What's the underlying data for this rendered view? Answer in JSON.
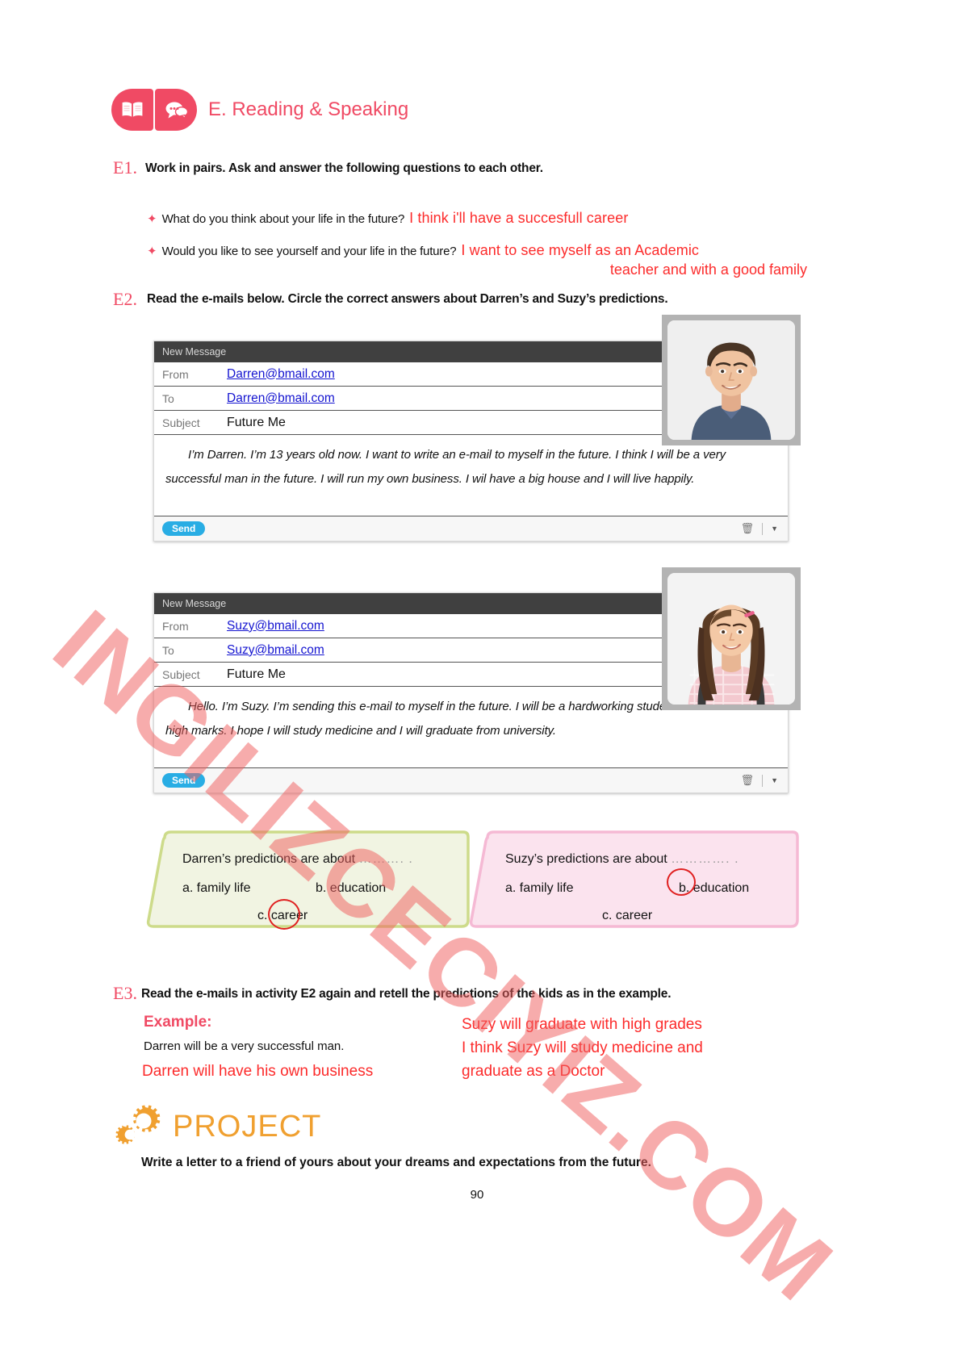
{
  "header": {
    "title": "E. Reading & Speaking",
    "icon_book": "book-icon",
    "icon_speech": "speech-bubble-icon",
    "accent_color": "#f04a64"
  },
  "e1": {
    "label": "E1.",
    "instruction": "Work in pairs. Ask and answer the following questions to each other.",
    "questions": [
      {
        "text": "What do you think about your life in the future?",
        "answer": "I think i'll have a succesfull career"
      },
      {
        "text": "Would you like to see yourself and your life in the future?",
        "answer": "I want to see myself as an Academic",
        "answer_line2": "teacher and with a good family"
      }
    ]
  },
  "e2": {
    "label": "E2.",
    "instruction": "Read the e-mails below. Circle the correct answers about Darren’s and Suzy’s predictions.",
    "emails": [
      {
        "titlebar": "New Message",
        "from_label": "From",
        "from_value": "Darren@bmail.com",
        "to_label": "To",
        "to_value": "Darren@bmail.com",
        "subject_label": "Subject",
        "subject_value": "Future Me",
        "body": "I’m Darren. I’m 13 years old now. I want to write an e-mail to myself in the future. I think I will be a very successful man in the future. I will run my own business. I wil have a big house and I will live happily.",
        "send_label": "Send",
        "trash_icon": "trash-icon",
        "caret_icon": "chevron-down-icon",
        "avatar": "boy-photo"
      },
      {
        "titlebar": "New Message",
        "from_label": "From",
        "from_value": "Suzy@bmail.com",
        "to_label": "To",
        "to_value": "Suzy@bmail.com",
        "subject_label": "Subject",
        "subject_value": "Future Me",
        "body": "Hello. I’m Suzy. I’m sending this e-mail to myself in the future. I will be a hardworking student and I will have high marks. I hope I will study medicine and I will graduate from university.",
        "send_label": "Send",
        "trash_icon": "trash-icon",
        "caret_icon": "chevron-down-icon",
        "avatar": "girl-photo"
      }
    ],
    "answer_boxes": [
      {
        "name": "darren",
        "question": "Darren’s predictions are about",
        "dots": "………. .",
        "option_a": "a. family life",
        "option_b": "b. education",
        "option_c": "c. career",
        "fill_color": "#f1f4e2",
        "stroke_color": "#cddb8a",
        "circled": "c"
      },
      {
        "name": "suzy",
        "question": "Suzy’s predictions are about",
        "dots": "…………. .",
        "option_a": "a. family life",
        "option_b": "b. education",
        "option_c": "c. career",
        "fill_color": "#fbe3ee",
        "stroke_color": "#f5b9d4",
        "circled": "b"
      }
    ]
  },
  "e3": {
    "label": "E3.",
    "instruction": "Read the e-mails in activity E2 again and retell the predictions of the kids as in the example.",
    "example_label": "Example:",
    "example_text": "Darren will be a very successful man.",
    "hand_left": "Darren will have his own business",
    "hand_right": "Suzy will graduate with high grades\nI think Suzy will study medicine and\ngraduate as a Doctor"
  },
  "project": {
    "title": "PROJECT",
    "gear_icon": "gear-icon",
    "description": "Write a letter to a friend of yours about your dreams and expectations from the future.",
    "accent_color": "#f0a030"
  },
  "footer": {
    "page_number": "90"
  },
  "watermark": {
    "text": "INGILIZCECIYIZ.COM"
  }
}
